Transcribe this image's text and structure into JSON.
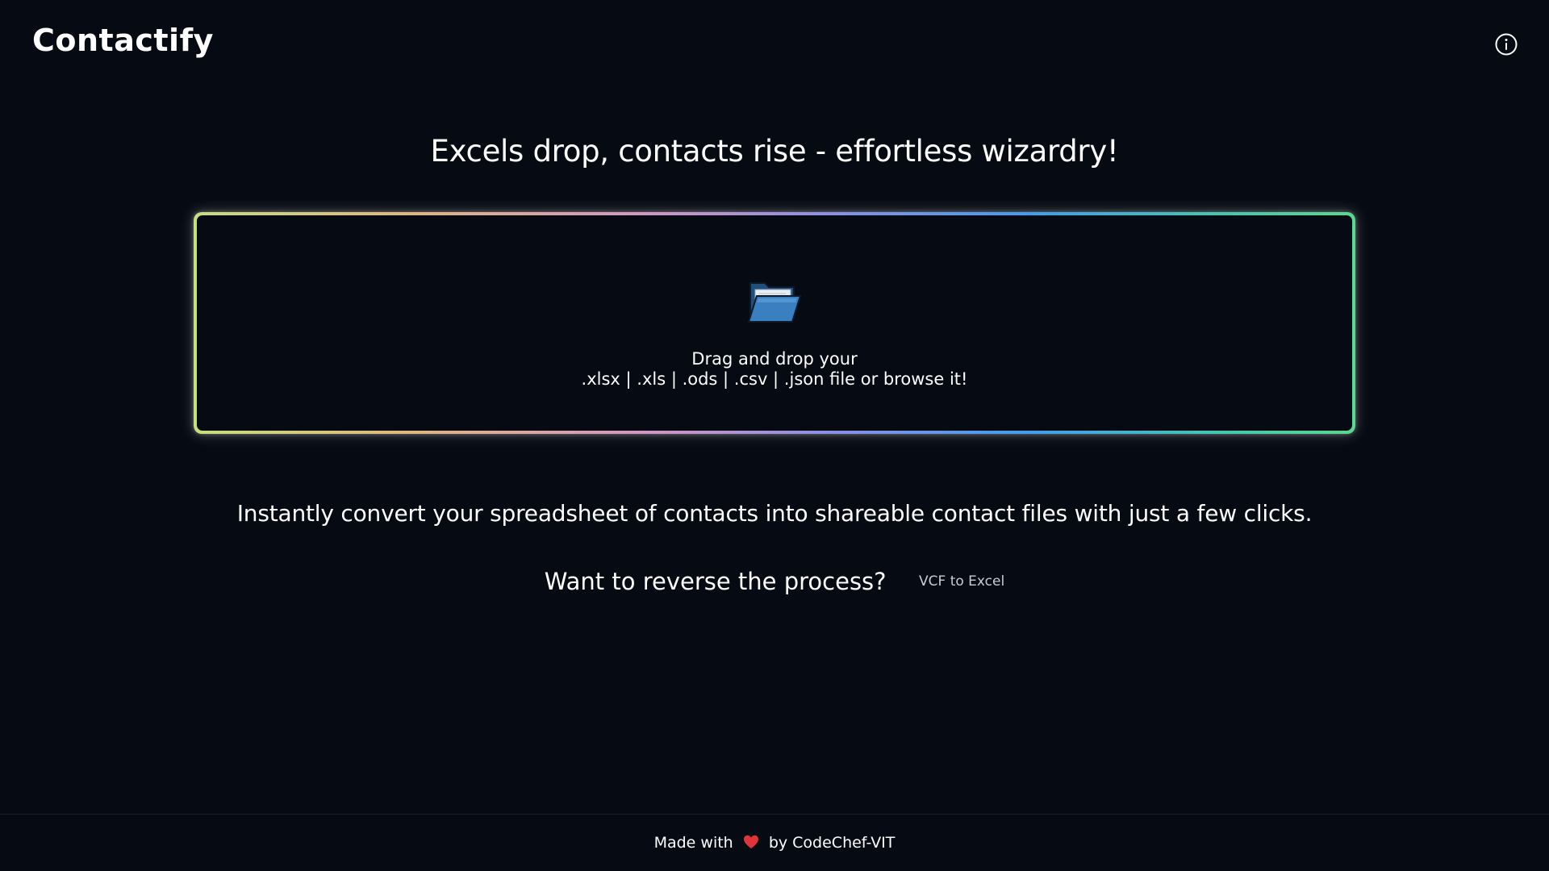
{
  "header": {
    "logo": "Contactify",
    "info_icon": "info-circle-icon"
  },
  "main": {
    "headline": "Excels drop, contacts rise - effortless wizardry!",
    "dropzone": {
      "icon": "open-folder-icon",
      "line1": "Drag and drop your",
      "line2": ".xlsx | .xls | .ods | .csv | .json file or browse it!",
      "border_colors": [
        "#c6e07a",
        "#e0b77d",
        "#d696c0",
        "#8a8fe6",
        "#3f9ef0",
        "#41c7b0",
        "#58d98e"
      ]
    },
    "subtext": "Instantly convert your spreadsheet of contacts into shareable contact files with just a few clicks.",
    "reverse": {
      "question": "Want to reverse the process?",
      "link_label": "VCF to Excel"
    }
  },
  "footer": {
    "prefix": "Made with",
    "heart_icon": "heart-icon",
    "suffix": "by CodeChef-VIT"
  },
  "colors": {
    "background": "#060a12",
    "text": "#ffffff",
    "muted_link": "#c9ccd3",
    "heart": "#e0343a"
  }
}
